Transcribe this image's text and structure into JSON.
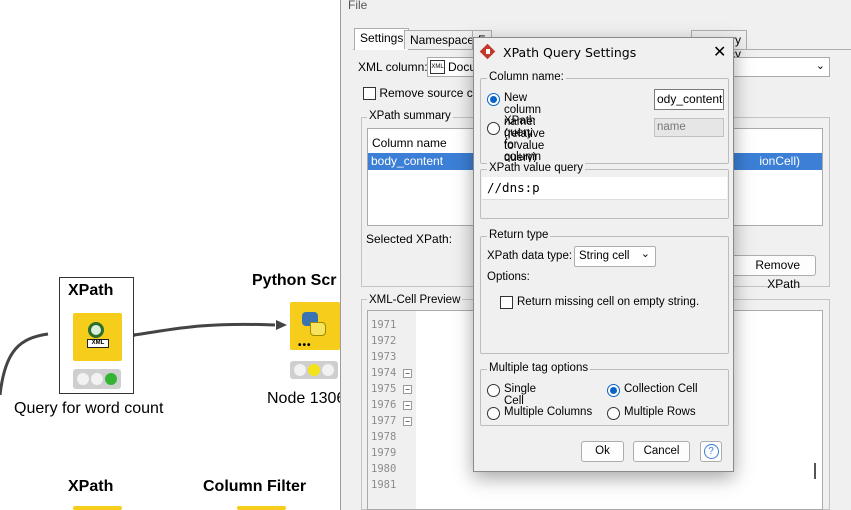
{
  "workflow": {
    "nodes": [
      {
        "title": "XPath",
        "label": "Query for word count",
        "icon": "xml-search-icon"
      },
      {
        "title": "Python Scr",
        "label": "Node 1306",
        "icon": "python-icon"
      },
      {
        "title": "XPath",
        "label": "",
        "icon": "xml-search-icon"
      },
      {
        "title": "Column Filter",
        "label": "",
        "icon": "filter-icon"
      }
    ],
    "xml_icon_text": "XML"
  },
  "dialog": {
    "menu_file": "File",
    "tabs": [
      "Settings",
      "Namespace",
      "F",
      "c",
      "Mu",
      "ory Policy"
    ],
    "xml_column_label": "XML column:",
    "xml_column_icon_text": "XML",
    "xml_column_value": "Docu",
    "remove_source_label": "Remove source colu",
    "xpath_summary_label": "XPath summary",
    "summary_col_header": "Column name",
    "summary_row_name": "body_content",
    "summary_row_type": "ionCell)",
    "selected_xpath_label": "Selected XPath:",
    "remove_xpath_button": "Remove XPath",
    "preview_label": "XML-Cell Preview",
    "line_numbers": [
      "1971",
      "1972",
      "1973",
      "1974",
      "1975",
      "1976",
      "1977",
      "1978",
      "1979",
      "1980",
      "1981"
    ],
    "fold_lines": [
      "1974",
      "1975",
      "1976",
      "1977"
    ]
  },
  "modal": {
    "title": "XPath Query Settings",
    "column_name_group": "Column name:",
    "new_column_radio": "New column name:",
    "new_column_value": "ody_content",
    "xpath_col_radio_line1": "XPath query for column name:",
    "xpath_col_radio_line2": "(relative to value query)",
    "xpath_col_placeholder": "name",
    "value_query_group": "XPath value query",
    "value_query_text": "//dns:p",
    "return_type_group": "Return type",
    "data_type_label": "XPath data type:",
    "data_type_value": "String cell",
    "options_label": "Options:",
    "return_missing_label": "Return missing cell on empty string.",
    "multiple_tag_group": "Multiple tag options",
    "opt_single": "Single Cell",
    "opt_collection": "Collection Cell",
    "opt_multi_cols": "Multiple Columns",
    "opt_multi_rows": "Multiple Rows",
    "ok_button": "Ok",
    "cancel_button": "Cancel",
    "help_glyph": "?"
  },
  "colors": {
    "selection": "#3c7fd6",
    "node_yellow": "#f5cd1a",
    "accent_blue": "#0a64c8"
  }
}
